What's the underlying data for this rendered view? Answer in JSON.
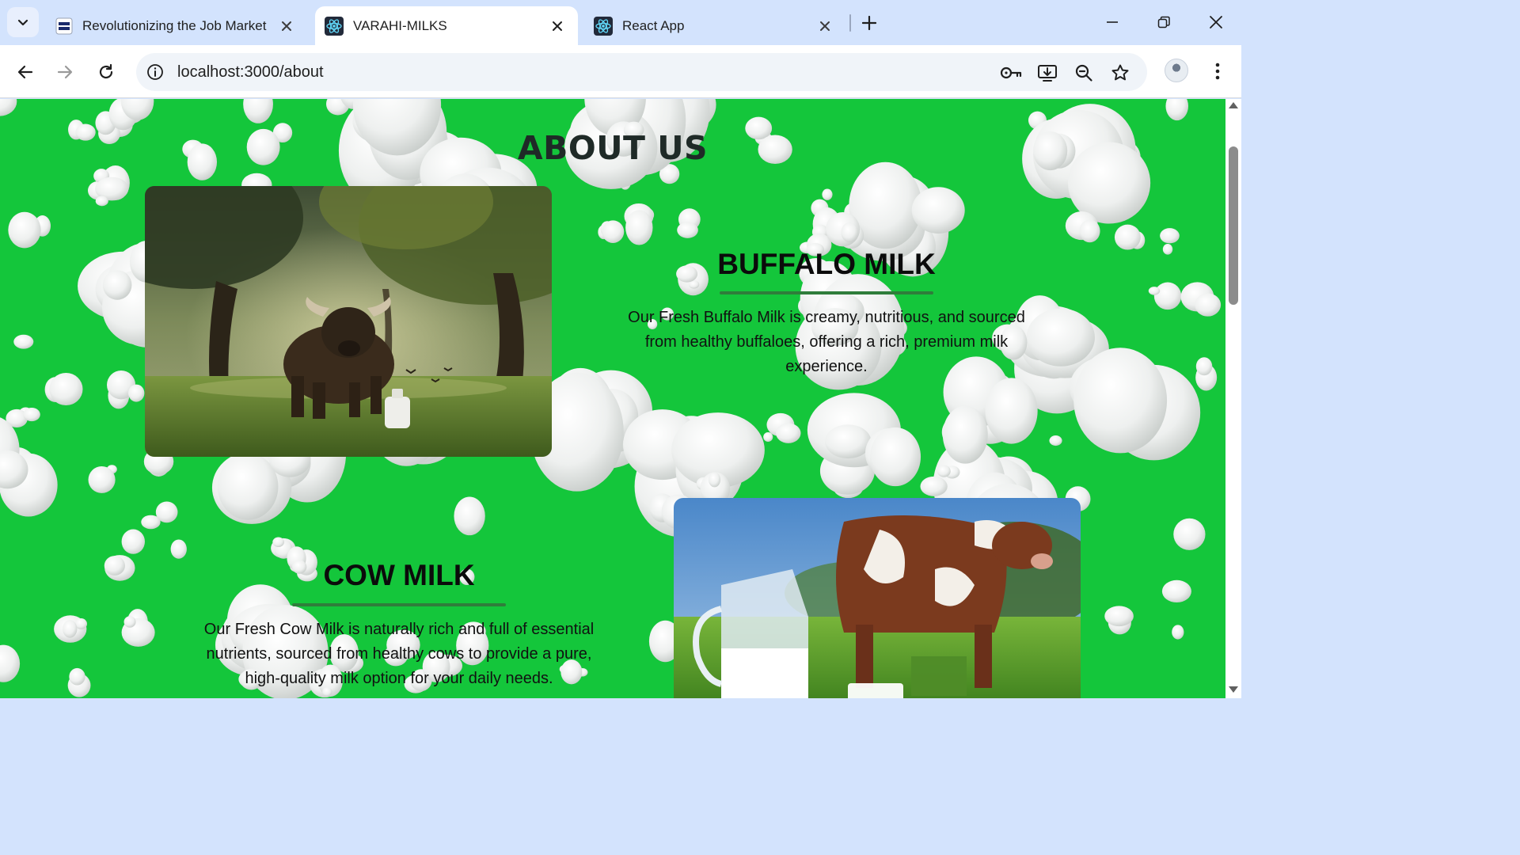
{
  "browser": {
    "tabs": [
      {
        "title": "Revolutionizing the Job Market",
        "icon": "nxtwave-favicon",
        "active": false
      },
      {
        "title": "VARAHI-MILKS",
        "icon": "react-favicon",
        "active": true
      },
      {
        "title": "React App",
        "icon": "react-favicon",
        "active": false
      }
    ],
    "url": "localhost:3000/about",
    "colors": {
      "tabstrip": "#d3e3fd",
      "toolbar": "#ffffff",
      "omnibox": "#f0f4f9"
    }
  },
  "page": {
    "background_color": "#14c63b",
    "title": "ABOUT US",
    "sections": [
      {
        "heading": "BUFFALO MILK",
        "text": "Our Fresh Buffalo Milk is creamy, nutritious, and sourced from healthy buffaloes, offering a rich, premium milk experience.",
        "image": "buffalo-in-meadow-with-milk-bottle"
      },
      {
        "heading": "COW MILK",
        "text": "Our Fresh Cow Milk is naturally rich and full of essential nutrients, sourced from healthy cows to provide a pure, high-quality milk option for your daily needs.",
        "image": "cow-in-pasture-with-milk-jug"
      }
    ]
  }
}
